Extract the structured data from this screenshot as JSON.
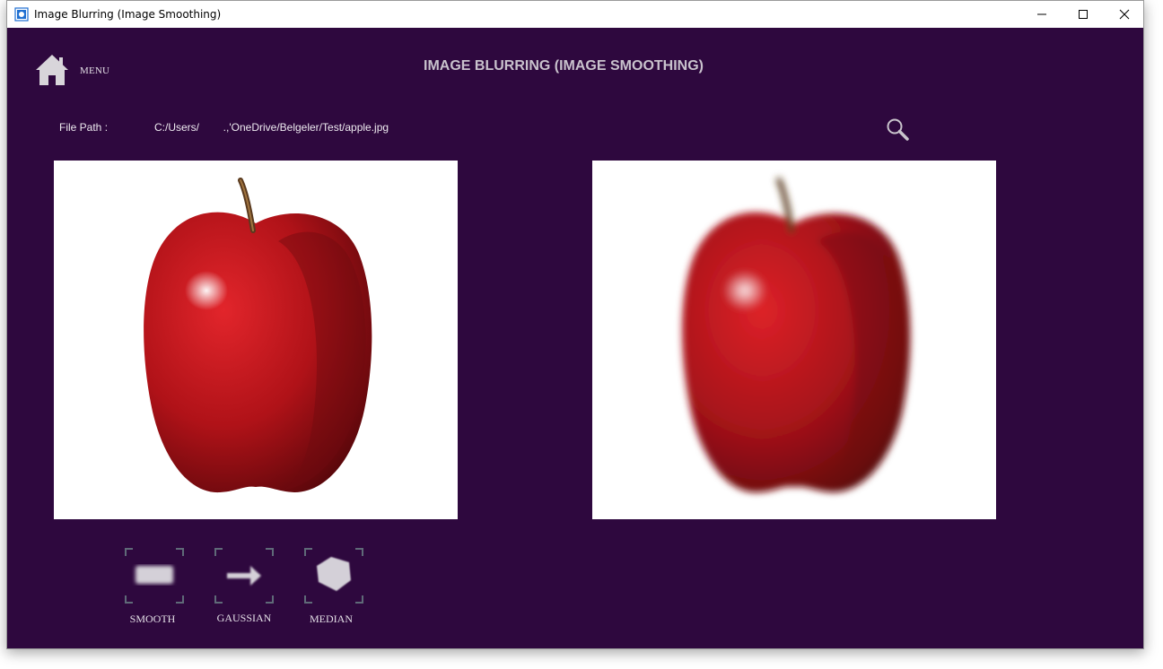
{
  "window": {
    "title": "Image Blurring (Image Smoothing)",
    "app_icon": "image-app-icon",
    "controls": [
      "minimize",
      "maximize",
      "close"
    ]
  },
  "header": {
    "menu_label": "MENU",
    "home_icon": "home-icon",
    "title": "IMAGE BLURRING (IMAGE SMOOTHING)"
  },
  "file": {
    "label": "File Path :",
    "path": "C:/Users/        .,'OneDrive/Belgeler/Test/apple.jpg",
    "search_icon": "search-icon"
  },
  "images": {
    "original_icon": "apple-image",
    "blurred_icon": "blurred-apple-image"
  },
  "filters": [
    {
      "label": "SMOOTH",
      "icon": "blur-rectangle-icon"
    },
    {
      "label": "GAUSSIAN",
      "icon": "arrow-right-icon"
    },
    {
      "label": "MEDIAN",
      "icon": "pentagon-icon"
    }
  ],
  "colors": {
    "background": "#2e083e",
    "title_text": "#c9c2cd",
    "apple_red": "#b01218"
  }
}
